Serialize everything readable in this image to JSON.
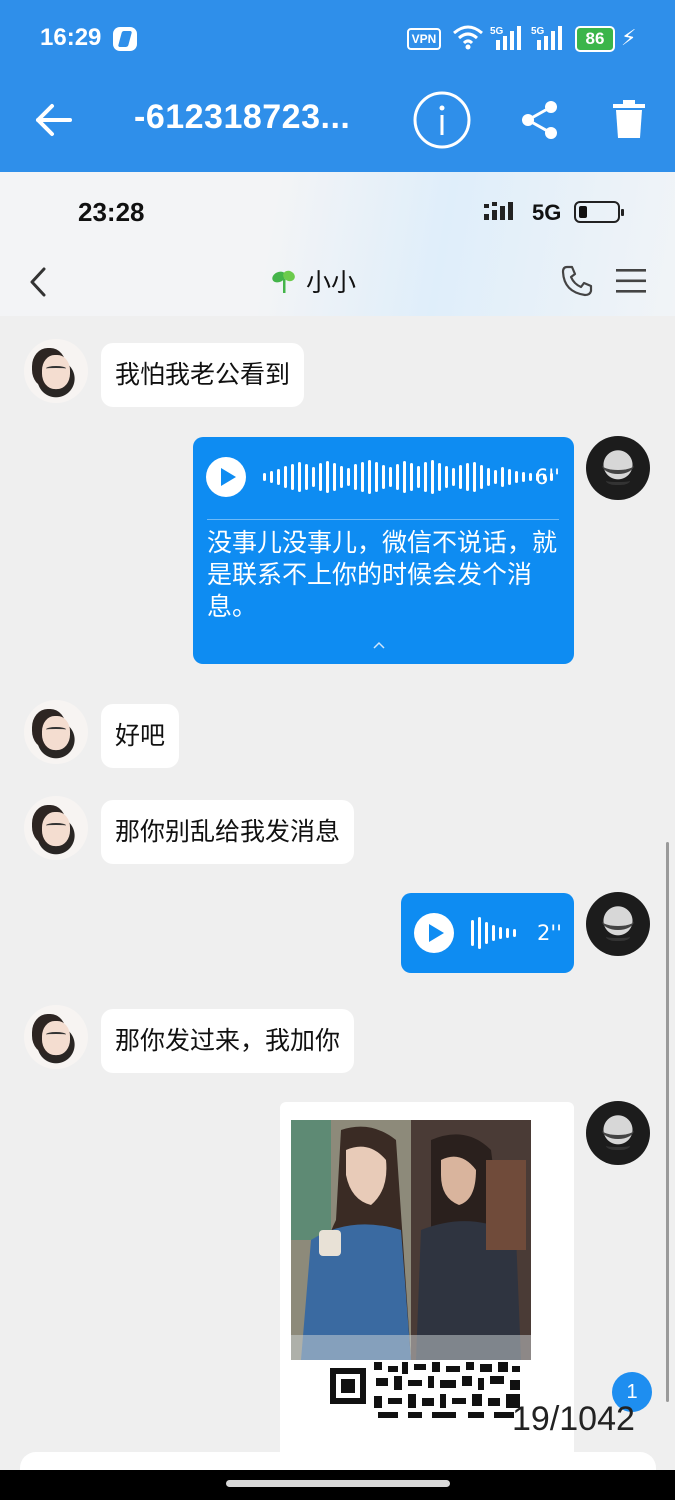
{
  "status_bar": {
    "time": "16:29",
    "vpn": "VPN",
    "network_1": "5G",
    "network_2": "5G",
    "battery": "86"
  },
  "app_bar": {
    "title": "-612318723...",
    "back_icon": "arrow-left-icon",
    "info_icon": "info-icon",
    "share_icon": "share-icon",
    "delete_icon": "trash-icon"
  },
  "inner_status": {
    "time": "23:28",
    "network": "5G"
  },
  "chat_header": {
    "title": "小小",
    "back_icon": "chevron-left-icon",
    "call_icon": "phone-icon",
    "menu_icon": "menu-icon"
  },
  "messages": [
    {
      "side": "in",
      "type": "text",
      "text": "我怕我老公看到"
    },
    {
      "side": "out",
      "type": "voice",
      "duration": "6''",
      "transcript": "没事儿没事儿，微信不说话，就是联系不上你的时候会发个消息。"
    },
    {
      "side": "in",
      "type": "text",
      "text": "好吧"
    },
    {
      "side": "in",
      "type": "text",
      "text": "那你别乱给我发消息"
    },
    {
      "side": "out",
      "type": "voice",
      "duration": "2''"
    },
    {
      "side": "in",
      "type": "text",
      "text": "那你发过来，我加你"
    },
    {
      "side": "out",
      "type": "image"
    }
  ],
  "viewer": {
    "unread_badge": "1",
    "page_counter": "19/1042"
  },
  "colors": {
    "app_bar": "#2f8fea",
    "voice_bubble": "#0e8cf2",
    "chat_bg": "#efefef"
  }
}
